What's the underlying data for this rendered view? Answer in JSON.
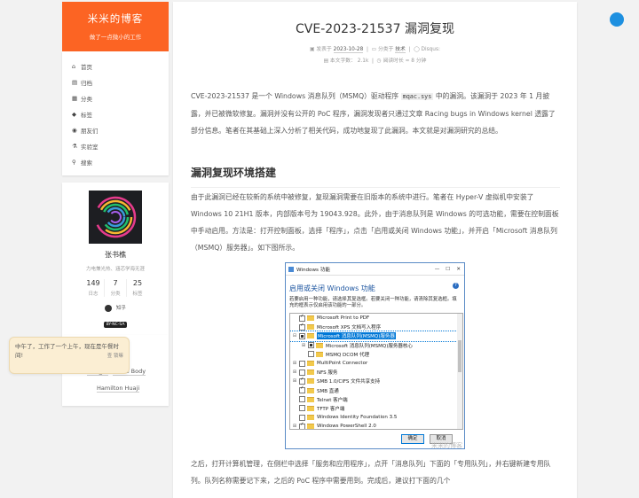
{
  "site": {
    "title": "米米的博客",
    "subtitle": "做了一点微小的工作"
  },
  "menu": [
    {
      "icon": "home-icon",
      "glyph": "⌂",
      "label": "首页"
    },
    {
      "icon": "archive-icon",
      "glyph": "▤",
      "label": "归档"
    },
    {
      "icon": "category-icon",
      "glyph": "▦",
      "label": "分类"
    },
    {
      "icon": "tag-icon",
      "glyph": "◆",
      "label": "标签"
    },
    {
      "icon": "friends-icon",
      "glyph": "◉",
      "label": "朋友们"
    },
    {
      "icon": "lab-icon",
      "glyph": "⚗",
      "label": "实验室"
    },
    {
      "icon": "search-icon",
      "glyph": "⚲",
      "label": "搜索"
    }
  ],
  "profile": {
    "name": "张书樵",
    "desc": "力电兼光热、涵芯学海无涯",
    "stats": [
      {
        "n": "149",
        "l": "日志"
      },
      {
        "n": "7",
        "l": "分类"
      },
      {
        "n": "25",
        "l": "标签"
      }
    ],
    "social": "知乎",
    "license": "BY-NC-SA"
  },
  "friends": [
    "ZSQ_IM",
    "Three Body",
    "Hamilton Huaji"
  ],
  "tooltip": {
    "text": "中午了，工作了一个上午，现在是午餐时间!",
    "sig": "查 锁嘛"
  },
  "post": {
    "title": "CVE-2023-21537 漏洞复现",
    "meta1": {
      "posted_label": "发表于",
      "date": "2023-10-28",
      "cat_label": "分类于",
      "category": "技术",
      "disqus": "Disqus:"
    },
    "meta2": {
      "words_label": "本文字数：",
      "words": "2.1k",
      "time_label": "阅读时长 ≈",
      "time": "8 分钟"
    },
    "p1a": "CVE-2023-21537 是一个 Windows 消息队列（MSMQ）驱动程序",
    "p1code": "mqac.sys",
    "p1b": "中的漏洞。该漏洞于 2023 年 1 月披露，并已被微软修复。漏洞并没有公开的 PoC 程序，漏洞发现者只通过文章 Racing bugs in Windows kernel 透露了部分信息。笔者在其基础上深入分析了相关代码，成功地复现了此漏洞。本文就是对漏洞研究的总结。",
    "h2": "漏洞复现环境搭建",
    "p2": "由于此漏洞已经在较新的系统中被修复，复现漏洞需要在旧版本的系统中进行。笔者在 Hyper-V 虚拟机中安装了 Windows 10 21H1 版本，内部版本号为 19043.928。此外，由于消息队列是 Windows 的可选功能，需要在控制面板中手动启用。方法是：打开控制面板，选择「程序」，点击「启用或关闭 Windows 功能」，并开启「Microsoft 消息队列（MSMQ）服务器」。如下图所示。",
    "p3": "之后，打开计算机管理，在侧栏中选择「服务和应用程序」，点开「消息队列」下面的「专用队列」，并右键新建专用队列。队列名称需要记下来，之后的 PoC 程序中需要用到。完成后，建议打下面的几个"
  },
  "dialog": {
    "title": "Windows 功能",
    "heading": "启用或关闭 Windows 功能",
    "desc": "若要启用一种功能，请选择其复选框。若要关闭一种功能，请清除其复选框。填充的框表示仅启用该功能的一部分。",
    "items": [
      {
        "indent": 0,
        "ex": "",
        "state": "on",
        "label": "Microsoft Print to PDF"
      },
      {
        "indent": 0,
        "ex": "",
        "state": "on",
        "label": "Microsoft XPS 文档写入程序"
      },
      {
        "indent": 0,
        "ex": "⊟",
        "state": "partial",
        "label": "Microsoft 消息队列(MSMQ)服务器",
        "selected": true
      },
      {
        "indent": 1,
        "ex": "⊞",
        "state": "partial",
        "label": "Microsoft 消息队列(MSMQ)服务器核心"
      },
      {
        "indent": 1,
        "ex": "",
        "state": "off",
        "label": "MSMQ DCOM 代理"
      },
      {
        "indent": 0,
        "ex": "⊞",
        "state": "off",
        "label": "MultiPoint Connector"
      },
      {
        "indent": 0,
        "ex": "⊞",
        "state": "off",
        "label": "NFS 服务"
      },
      {
        "indent": 0,
        "ex": "⊞",
        "state": "on",
        "label": "SMB 1.0/CIFS 文件共享支持"
      },
      {
        "indent": 0,
        "ex": "",
        "state": "on",
        "label": "SMB 直通"
      },
      {
        "indent": 0,
        "ex": "",
        "state": "off",
        "label": "Telnet 客户端"
      },
      {
        "indent": 0,
        "ex": "",
        "state": "off",
        "label": "TFTP 客户端"
      },
      {
        "indent": 0,
        "ex": "",
        "state": "off",
        "label": "Windows Identity Foundation 3.5"
      },
      {
        "indent": 0,
        "ex": "⊞",
        "state": "on",
        "label": "Windows PowerShell 2.0"
      }
    ],
    "ok": "确定",
    "cancel": "取消",
    "watermark": "米米的博客"
  }
}
